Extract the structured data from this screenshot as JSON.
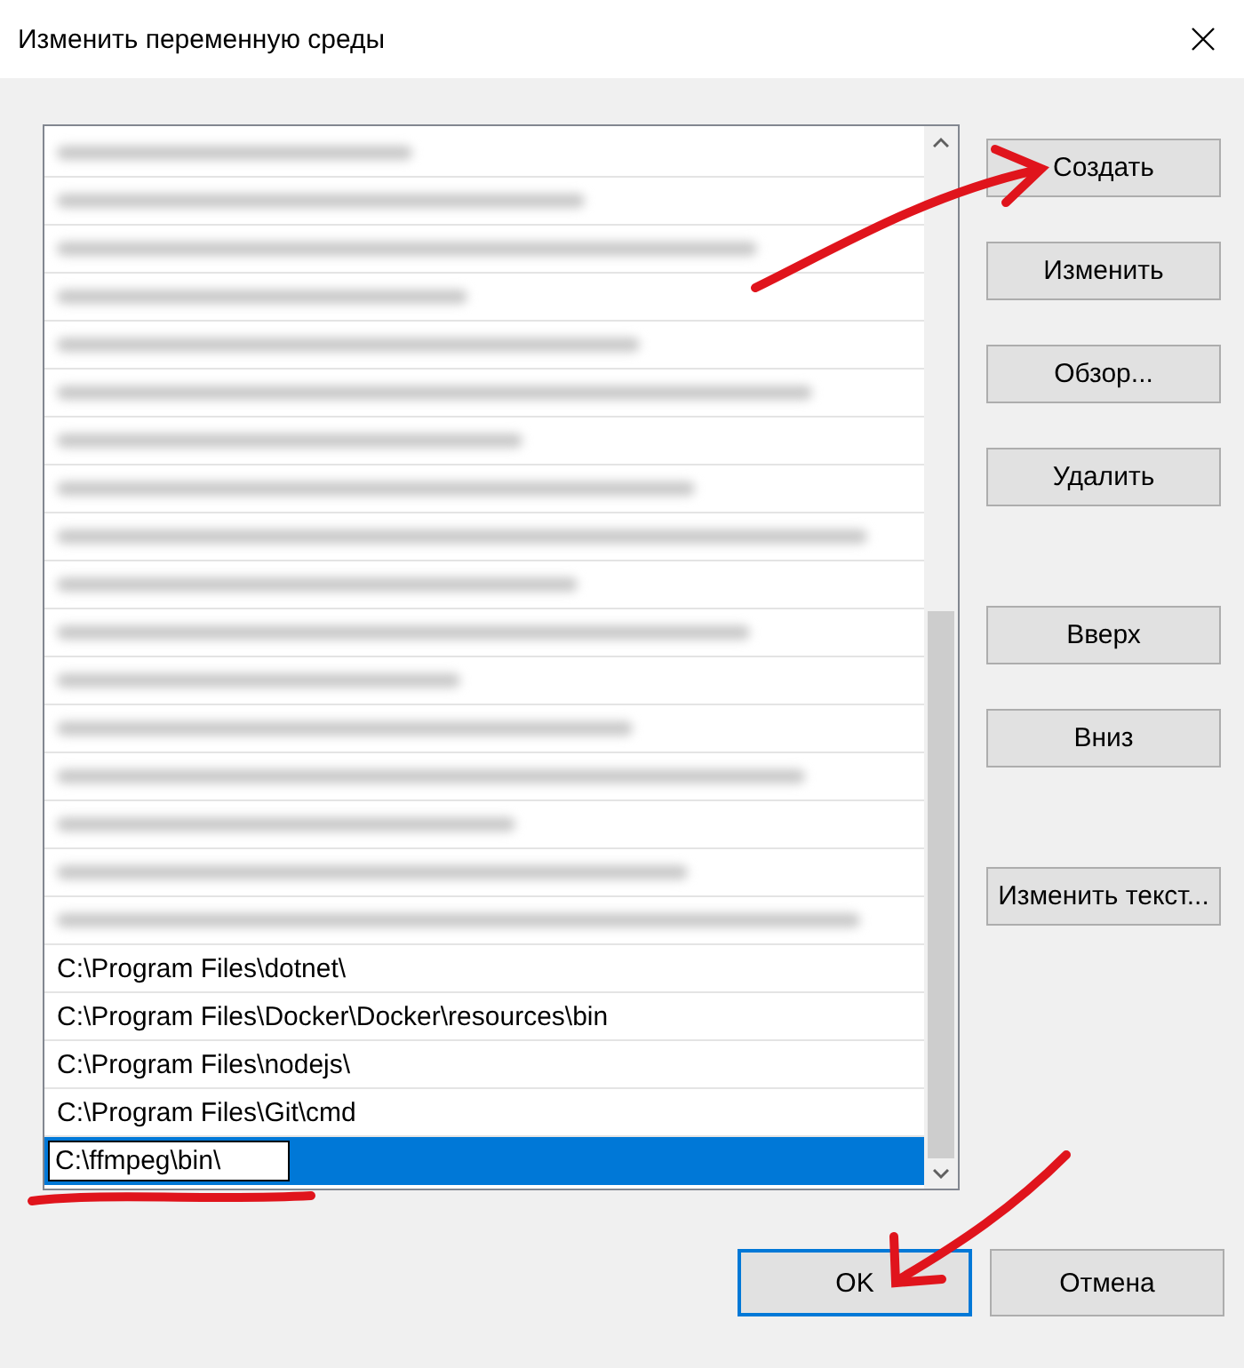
{
  "window": {
    "title": "Изменить переменную среды"
  },
  "list": {
    "rows": [
      {
        "kind": "blurred",
        "selected": false
      },
      {
        "kind": "blurred",
        "selected": false
      },
      {
        "kind": "blurred",
        "selected": false
      },
      {
        "kind": "blurred",
        "selected": false
      },
      {
        "kind": "blurred",
        "selected": false
      },
      {
        "kind": "blurred",
        "selected": false
      },
      {
        "kind": "blurred",
        "selected": false
      },
      {
        "kind": "blurred",
        "selected": false
      },
      {
        "kind": "blurred",
        "selected": false
      },
      {
        "kind": "blurred",
        "selected": false
      },
      {
        "kind": "blurred",
        "selected": false
      },
      {
        "kind": "blurred",
        "selected": false
      },
      {
        "kind": "blurred",
        "selected": false
      },
      {
        "kind": "blurred",
        "selected": false
      },
      {
        "kind": "blurred",
        "selected": false
      },
      {
        "kind": "blurred",
        "selected": false
      },
      {
        "kind": "blurred",
        "selected": false
      },
      {
        "kind": "path",
        "text": "C:\\Program Files\\dotnet\\",
        "selected": false
      },
      {
        "kind": "path",
        "text": "C:\\Program Files\\Docker\\Docker\\resources\\bin",
        "selected": false
      },
      {
        "kind": "path",
        "text": "C:\\Program Files\\nodejs\\",
        "selected": false
      },
      {
        "kind": "path",
        "text": "C:\\Program Files\\Git\\cmd",
        "selected": false
      },
      {
        "kind": "editing",
        "value": "C:\\ffmpeg\\bin\\",
        "selected": true
      }
    ]
  },
  "button_groups": [
    [
      "Создать",
      "Изменить",
      "Обзор...",
      "Удалить"
    ],
    [
      "Вверх",
      "Вниз"
    ],
    [
      "Изменить текст..."
    ]
  ],
  "footer_buttons": [
    {
      "label": "OK",
      "default": true
    },
    {
      "label": "Отмена",
      "default": false
    }
  ],
  "annotations": [
    {
      "kind": "arrow"
    },
    {
      "kind": "underline"
    },
    {
      "kind": "arrow"
    }
  ]
}
